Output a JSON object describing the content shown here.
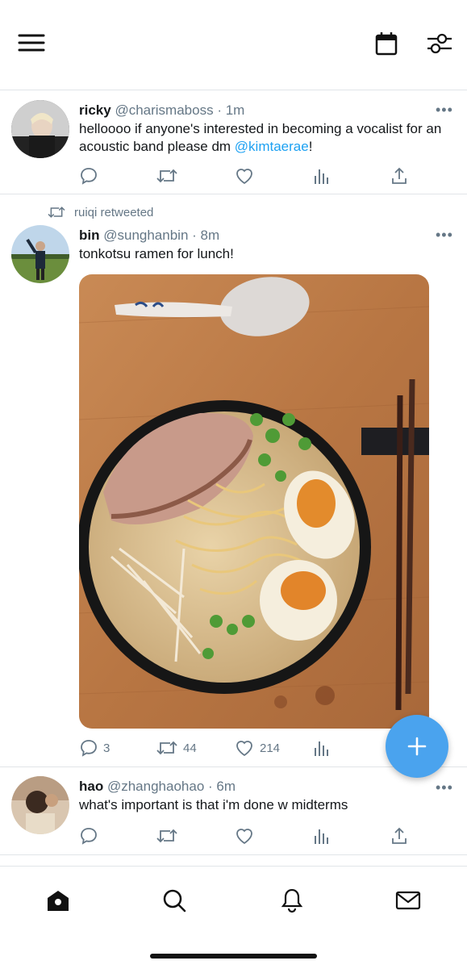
{
  "header": {
    "menu_icon": "hamburger-menu-icon",
    "calendar_icon": "calendar-icon",
    "filter_icon": "sliders-icon"
  },
  "tweets": [
    {
      "name": "ricky",
      "handle": "@charismaboss",
      "time": "· 1m",
      "text_before": "helloooo if anyone's interested in becoming a vocalist for an acoustic band please dm ",
      "mention": "@kimtaerae",
      "text_after": "!",
      "more": "•••"
    },
    {
      "retweeted_by": "ruiqi retweeted",
      "name": "bin",
      "handle": "@sunghanbin",
      "time": "· 8m",
      "text": "tonkotsu ramen for lunch!",
      "more": "•••",
      "replies": "3",
      "retweets": "44",
      "likes": "214"
    },
    {
      "name": "hao",
      "handle": "@zhanghaohao",
      "time": "· 6m",
      "text": "what's important is that i'm done w midterms",
      "more": "•••"
    }
  ],
  "fab": {
    "label": "+"
  },
  "nav": [
    "home-icon",
    "search-icon",
    "notifications-icon",
    "messages-icon"
  ],
  "colors": {
    "accent": "#1da1f2",
    "fab": "#4aa3ee",
    "muted": "#657786"
  }
}
